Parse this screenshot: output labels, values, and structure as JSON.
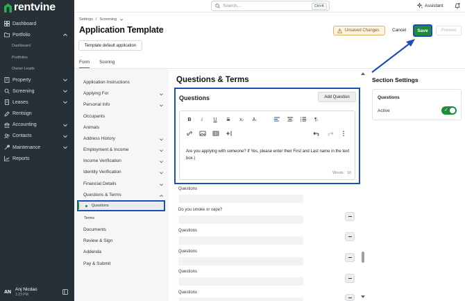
{
  "app": {
    "name": "rentvine"
  },
  "sidebar": {
    "items": [
      {
        "label": "Dashboard",
        "icon": "dashboard-icon"
      },
      {
        "label": "Portfolio",
        "icon": "folder-icon",
        "expanded": true
      },
      {
        "label": "Property",
        "icon": "building-icon"
      },
      {
        "label": "Screening",
        "icon": "screening-icon"
      },
      {
        "label": "Leases",
        "icon": "lease-icon"
      },
      {
        "label": "Rentsign",
        "icon": "pen-icon"
      },
      {
        "label": "Accounting",
        "icon": "bank-icon"
      },
      {
        "label": "Contacts",
        "icon": "contacts-icon"
      },
      {
        "label": "Maintenance",
        "icon": "wrench-icon"
      },
      {
        "label": "Reports",
        "icon": "chart-icon"
      }
    ],
    "portfolio_sub": [
      "Dashboard",
      "Portfolios",
      "Owner Leads"
    ],
    "user": {
      "initials": "AN",
      "name": "Anj Nicdao",
      "time": "1:23 PM"
    }
  },
  "topbar": {
    "search_placeholder": "Search...",
    "shortcut": "Ctrl+K",
    "assistant": "Assistant"
  },
  "header": {
    "breadcrumb": [
      "Settings",
      "/",
      "Screening"
    ],
    "title": "Application Template",
    "template_button": "Template default application",
    "unsaved": "Unsaved Changes",
    "cancel": "Cancel",
    "save": "Save",
    "preview": "Preview"
  },
  "tabs": [
    {
      "label": "Form",
      "active": true
    },
    {
      "label": "Scoring",
      "active": false
    }
  ],
  "sections": {
    "items": [
      "Application Instructions",
      "Applying For",
      "Personal Info",
      "Occupants",
      "Animals",
      "Address History",
      "Employment & Income",
      "Income Verification",
      "Identity Verification",
      "Financial Details",
      "Questions & Terms",
      "Documents",
      "Review & Sign",
      "Addenda",
      "Pay & Submit"
    ],
    "sub_items": [
      "Questions",
      "Terms"
    ]
  },
  "main": {
    "title": "Questions & Terms",
    "card_title": "Questions",
    "add_question": "Add Question",
    "editor_text": "Are you applying with someone? If Yes, please enter their First and Last name in the text box.",
    "words_label": "Words",
    "words_count": "18",
    "questions": [
      {
        "label": "Questions"
      },
      {
        "label": "Do you smoke or vape?"
      },
      {
        "label": "Questions"
      },
      {
        "label": "Questions"
      },
      {
        "label": "Questions"
      },
      {
        "label": "Questions"
      }
    ]
  },
  "section_settings": {
    "title": "Section Settings",
    "name": "Questions",
    "active_label": "Active",
    "active": true
  },
  "colors": {
    "sidebar_bg": "#263036",
    "brand_green": "#1f8a3b",
    "highlight_blue": "#1b4fb3",
    "warning_bg": "#fdf3e1"
  }
}
